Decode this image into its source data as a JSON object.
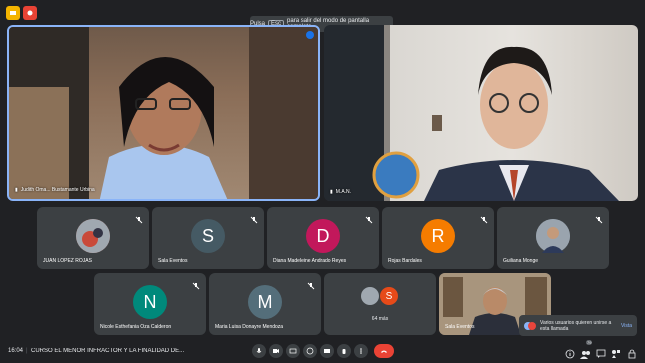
{
  "banner": {
    "prefix": "Pulsa",
    "key": "Esc",
    "suffix": "para salir del modo de pantalla completa"
  },
  "main_tiles": [
    {
      "name": "Judith Oma... Bustamante Urbina"
    },
    {
      "name": "M.A.N."
    }
  ],
  "grid_row1": [
    {
      "name": "JUAN LOPEZ ROJAS",
      "initial": "",
      "color": ""
    },
    {
      "name": "Sala Eventos",
      "initial": "S",
      "color": "#455a64"
    },
    {
      "name": "Diana Madeleine Andrado Reyes",
      "initial": "D",
      "color": "#c2185b"
    },
    {
      "name": "Rojas Bardales",
      "initial": "R",
      "color": "#f57c00"
    },
    {
      "name": "Guiliana Monge",
      "initial": "",
      "color": ""
    }
  ],
  "grid_row2": [
    {
      "name": "Nicole Esthefania Oza Calderon",
      "initial": "N",
      "color": "#00897b"
    },
    {
      "name": "Maria Luisa Donayre Mendoza",
      "initial": "M",
      "color": "#546e7a"
    },
    {
      "name": "64 más",
      "initial": "S",
      "color": "#e64a19"
    },
    {
      "name": "Sala Eventos",
      "initial": "",
      "color": ""
    }
  ],
  "toast": {
    "text": "Varios usuarios quieren unirse a esta llamada",
    "action": "Vista"
  },
  "bottom": {
    "time": "16:04",
    "separator": "|",
    "meeting_title": "CURSO EL MENOR INFRACTOR Y LA FINALIDAD DE...",
    "participants_count": "79"
  },
  "colors": {
    "accent": "#8ab4f8",
    "end_call": "#ea4335",
    "background": "#202124"
  }
}
